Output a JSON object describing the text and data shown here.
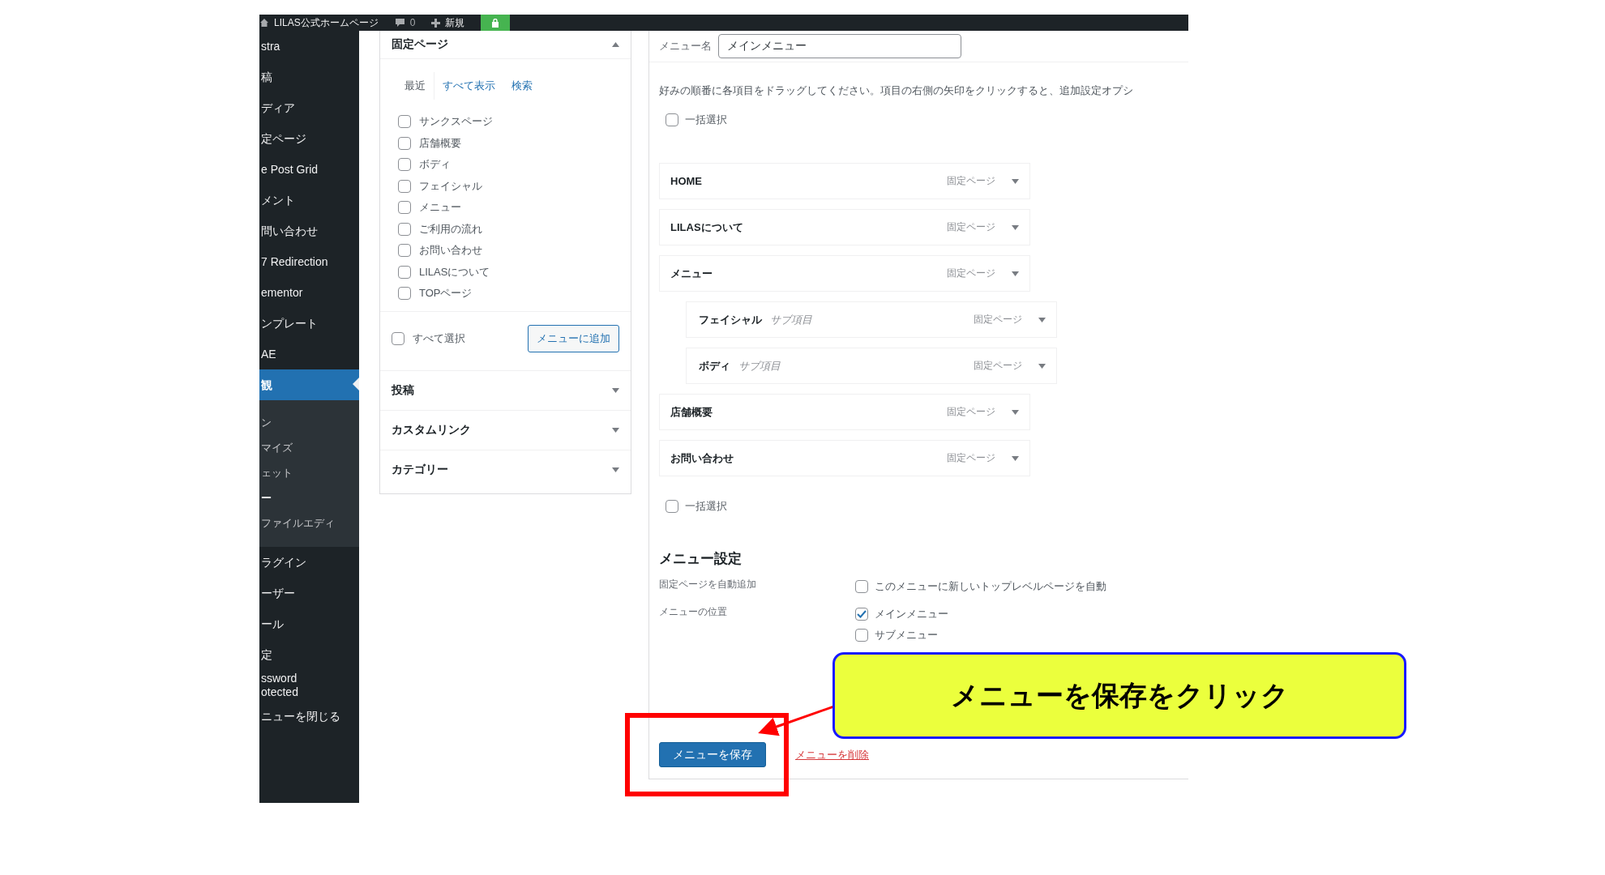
{
  "top_bar": {
    "site_name": "LILAS公式ホームページ",
    "comments": "0",
    "new_label": "新規"
  },
  "sidebar": {
    "items": [
      {
        "label": "stra",
        "selected": false
      },
      {
        "label": "稿",
        "selected": false
      },
      {
        "label": "ディア",
        "selected": false
      },
      {
        "label": "定ページ",
        "selected": false
      },
      {
        "label": "e Post Grid",
        "selected": false
      },
      {
        "label": "メント",
        "selected": false
      },
      {
        "label": "問い合わせ",
        "selected": false
      },
      {
        "label": "7 Redirection",
        "selected": false
      },
      {
        "label": "ementor",
        "selected": false
      },
      {
        "label": "ンプレート",
        "selected": false
      },
      {
        "label": "AE",
        "selected": false
      },
      {
        "label": "観",
        "selected": true,
        "children": [
          {
            "label": "ン",
            "selected": false
          },
          {
            "label": "マイズ",
            "selected": false
          },
          {
            "label": "ェット",
            "selected": false
          },
          {
            "label": "ー",
            "selected": true
          },
          {
            "label": "ファイルエディ",
            "selected": false
          }
        ]
      },
      {
        "label": "ラグイン",
        "selected": false
      },
      {
        "label": "ーザー",
        "selected": false
      },
      {
        "label": "ール",
        "selected": false
      },
      {
        "label": "定",
        "selected": false
      },
      {
        "label": "ssword\notected",
        "selected": false
      },
      {
        "label": "ニューを閉じる",
        "selected": false
      }
    ]
  },
  "add_items": {
    "title": "固定ページ",
    "expanded": true,
    "tabs": [
      {
        "label": "最近",
        "selected": true
      },
      {
        "label": "すべて表示",
        "selected": false
      },
      {
        "label": "検索",
        "selected": false
      }
    ],
    "pages": [
      {
        "label": "サンクスページ",
        "checked": false
      },
      {
        "label": "店舗概要",
        "checked": false
      },
      {
        "label": "ボディ",
        "checked": false
      },
      {
        "label": "フェイシャル",
        "checked": false
      },
      {
        "label": "メニュー",
        "checked": false
      },
      {
        "label": "ご利用の流れ",
        "checked": false
      },
      {
        "label": "お問い合わせ",
        "checked": false
      },
      {
        "label": "LILASについて",
        "checked": false
      },
      {
        "label": "TOPページ",
        "checked": false
      }
    ],
    "select_all": {
      "label": "すべて選択",
      "checked": false
    },
    "add_button": "メニューに追加",
    "other_sections": [
      {
        "title": "投稿",
        "expanded": false
      },
      {
        "title": "カスタムリンク",
        "expanded": false
      },
      {
        "title": "カテゴリー",
        "expanded": false
      }
    ]
  },
  "menu_structure": {
    "menu_name": {
      "label": "メニュー名",
      "value": "メインメニュー"
    },
    "instructions": "好みの順番に各項目をドラッグしてください。項目の右側の矢印をクリックすると、追加設定オプシ",
    "bulk_select_top": {
      "label": "一括選択",
      "checked": false
    },
    "menu_items": [
      {
        "title": "HOME",
        "type": "固定ページ"
      },
      {
        "title": "LILASについて",
        "type": "固定ページ"
      },
      {
        "title": "メニュー",
        "type": "固定ページ",
        "children": [
          {
            "title": "フェイシャル",
            "sub_label": "サブ項目",
            "type": "固定ページ"
          },
          {
            "title": "ボディ",
            "sub_label": "サブ項目",
            "type": "固定ページ"
          }
        ]
      },
      {
        "title": "店舗概要",
        "type": "固定ページ"
      },
      {
        "title": "お問い合わせ",
        "type": "固定ページ"
      }
    ],
    "bulk_select_bottom": {
      "label": "一括選択",
      "checked": false
    },
    "settings": {
      "title": "メニュー設定",
      "rows": [
        {
          "label": "固定ページを自動追加",
          "options": [
            {
              "label": "このメニューに新しいトップレベルページを自動",
              "checked": false
            }
          ]
        },
        {
          "label": "メニューの位置",
          "options": [
            {
              "label": "メインメニュー",
              "checked": true
            },
            {
              "label": "サブメニュー",
              "checked": false
            }
          ]
        }
      ]
    },
    "save_button": "メニューを保存",
    "delete_link": "メニューを削除"
  },
  "annotation": {
    "callout": "メニューを保存をクリック"
  }
}
